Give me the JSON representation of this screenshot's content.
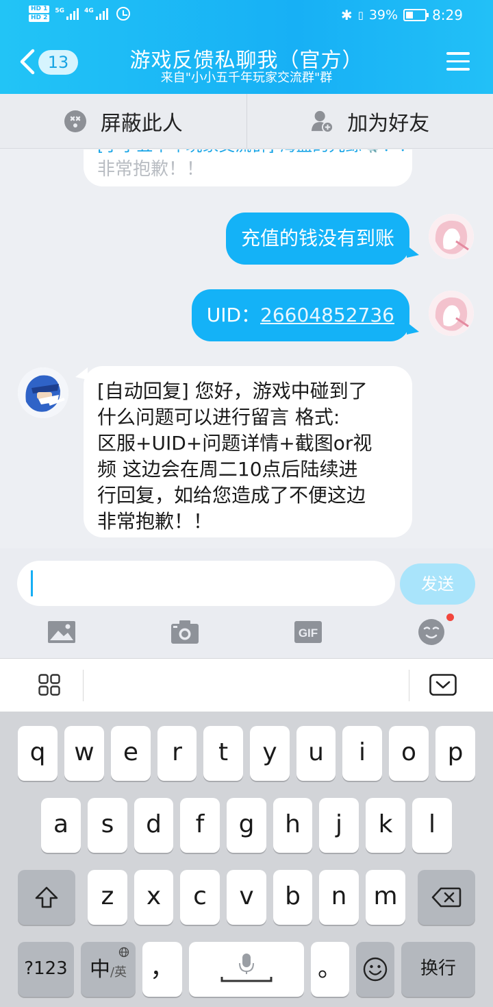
{
  "status_bar": {
    "hd1": "HD 1",
    "hd2": "HD 2",
    "net1": "5G",
    "net2": "4G",
    "battery": "39%",
    "time": "8:29"
  },
  "header": {
    "back_count": "13",
    "title": "游戏反馈私聊我（官方）",
    "subtitle": "来自\"小小五千年玩家交流群\"群"
  },
  "actions": {
    "block": "屏蔽此人",
    "add_friend": "加为好友"
  },
  "chat": {
    "prev_fragment_line1": "[小小五千年玩家交流群] 海盐的咒鲸🐳！！",
    "prev_fragment_line2": "非常抱歉！！",
    "msg1": "充值的钱没有到账",
    "msg2_label": "UID：",
    "msg2_uid": "26604852736",
    "msg3_lines": [
      "[自动回复] 您好，游戏中碰到了",
      "什么问题可以进行留言 格式:",
      "区服+UID+问题详情+截图or视",
      "频 这边会在周二10点后陆续进",
      "行回复，如给您造成了不便这边",
      "非常抱歉！！"
    ]
  },
  "input": {
    "value": "",
    "send": "发送"
  },
  "tools": [
    "image-icon",
    "camera-icon",
    "gif-icon",
    "emoji-icon"
  ],
  "tool_labels": {
    "gif": "GIF"
  },
  "keyboard": {
    "row1": [
      "q",
      "w",
      "e",
      "r",
      "t",
      "y",
      "u",
      "i",
      "o",
      "p"
    ],
    "row2": [
      "a",
      "s",
      "d",
      "f",
      "g",
      "h",
      "j",
      "k",
      "l"
    ],
    "row3": [
      "z",
      "x",
      "c",
      "v",
      "b",
      "n",
      "m"
    ],
    "num": "?123",
    "lang_main": "中",
    "lang_sub": "/英",
    "comma": "，",
    "period": "。",
    "enter": "换行"
  },
  "colors": {
    "header": "#17b0f5",
    "bubble_out": "#14b2f7",
    "send_disabled": "#a9e4fb",
    "badge_dot": "#f2463d"
  }
}
